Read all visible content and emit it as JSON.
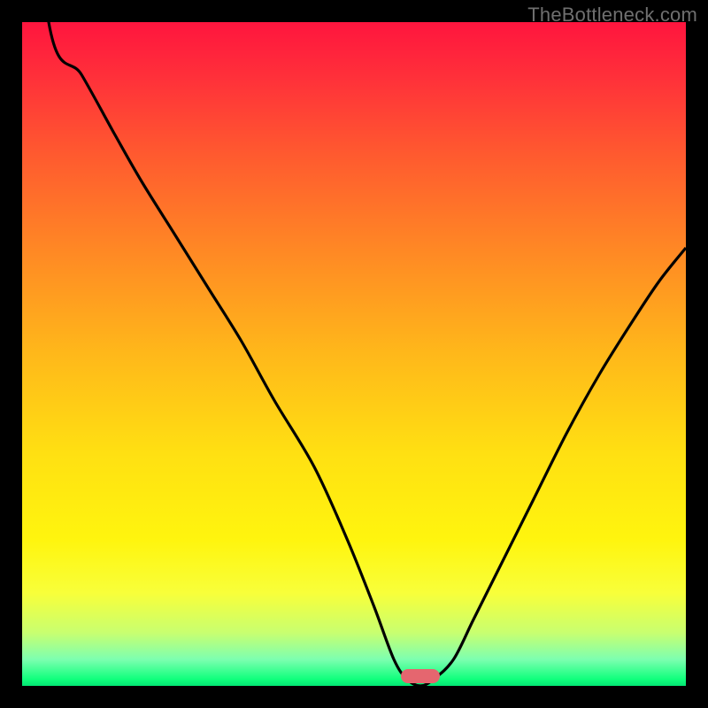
{
  "watermark_text": "TheBottleneck.com",
  "colors": {
    "frame_bg": "#000000",
    "curve_stroke": "#000000",
    "marker_fill": "#e5666f",
    "watermark_color": "#6f6f6f",
    "gradient_stops": [
      {
        "offset": 0.0,
        "color": "#ff153e"
      },
      {
        "offset": 0.08,
        "color": "#ff2f3a"
      },
      {
        "offset": 0.2,
        "color": "#ff5a2f"
      },
      {
        "offset": 0.35,
        "color": "#ff8a24"
      },
      {
        "offset": 0.5,
        "color": "#ffb81a"
      },
      {
        "offset": 0.65,
        "color": "#ffe012"
      },
      {
        "offset": 0.78,
        "color": "#fff50e"
      },
      {
        "offset": 0.86,
        "color": "#f8ff3a"
      },
      {
        "offset": 0.92,
        "color": "#c8ff70"
      },
      {
        "offset": 0.96,
        "color": "#7dffb0"
      },
      {
        "offset": 0.99,
        "color": "#10ff7c"
      },
      {
        "offset": 1.0,
        "color": "#04e574"
      }
    ]
  },
  "chart_data": {
    "type": "line",
    "title": "",
    "xlabel": "",
    "ylabel": "",
    "xlim": [
      0,
      100
    ],
    "ylim": [
      0,
      100
    ],
    "note": "x and y are percentages of the plot area; y=0 is bottom (green / optimal), y=100 is top (red / bottleneck). V-shaped bottleneck curve with optimal point at the valley.",
    "series": [
      {
        "name": "bottleneck-curve",
        "x": [
          0,
          4,
          9,
          14,
          18,
          23,
          28,
          33,
          38,
          44,
          49,
          53,
          56,
          58,
          60,
          62,
          65,
          68,
          72,
          77,
          82,
          87,
          92,
          96,
          100
        ],
        "y": [
          143,
          100,
          92,
          83,
          76,
          68,
          60,
          52,
          43,
          33,
          22,
          12,
          4,
          1,
          0,
          1,
          4,
          10,
          18,
          28,
          38,
          47,
          55,
          61,
          66
        ]
      }
    ],
    "marker": {
      "x": 60,
      "y": 1.5,
      "shape": "pill",
      "color": "#e5666f"
    }
  }
}
